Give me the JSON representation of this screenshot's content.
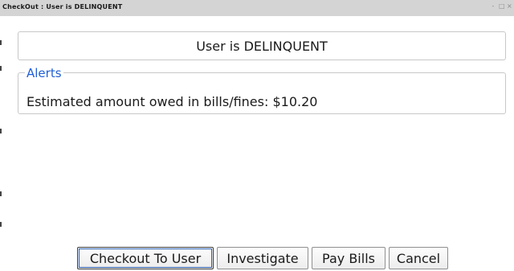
{
  "window": {
    "title": "CheckOut : User is DELINQUENT",
    "controls": [
      "-",
      "□",
      "×"
    ]
  },
  "header": {
    "message": "User is DELINQUENT"
  },
  "alerts": {
    "legend": "Alerts",
    "message": "Estimated amount owed in bills/fines: $10.20"
  },
  "buttons": {
    "checkout": "Checkout To User",
    "investigate": "Investigate",
    "pay_bills": "Pay Bills",
    "cancel": "Cancel"
  },
  "colors": {
    "legend_accent": "#1f5fd6",
    "titlebar": "#d4d4d4"
  }
}
